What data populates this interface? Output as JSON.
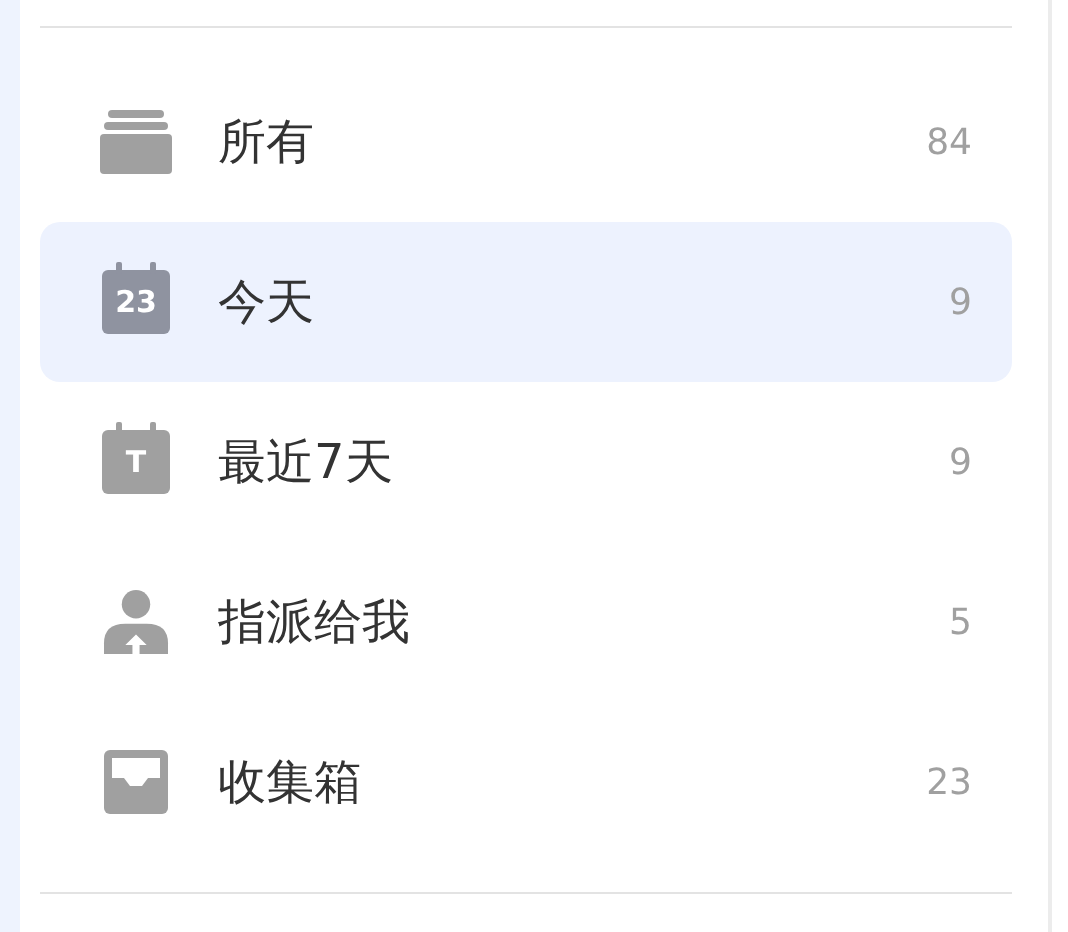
{
  "items": [
    {
      "kind": "stack",
      "label": "所有",
      "count": "84",
      "selected": false
    },
    {
      "kind": "calendar",
      "icon_text": "23",
      "label": "今天",
      "count": "9",
      "selected": true
    },
    {
      "kind": "calendar",
      "icon_text": "T",
      "label": "最近7天",
      "count": "9",
      "selected": false
    },
    {
      "kind": "person",
      "label": "指派给我",
      "count": "5",
      "selected": false
    },
    {
      "kind": "inbox",
      "label": "收集箱",
      "count": "23",
      "selected": false
    }
  ]
}
